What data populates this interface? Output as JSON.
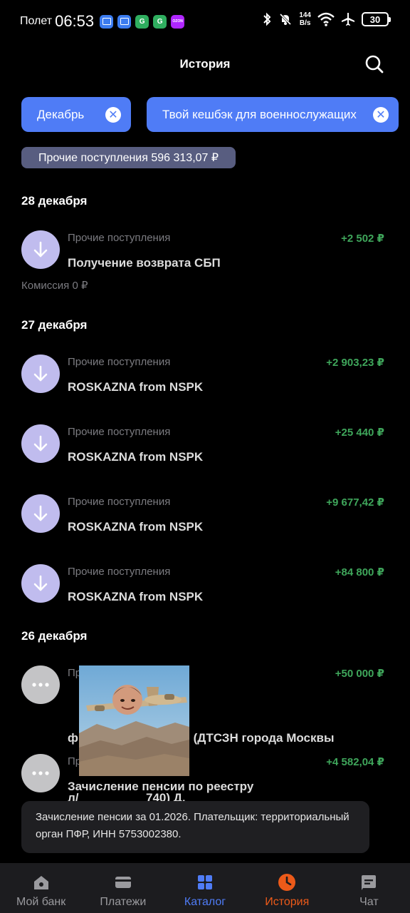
{
  "status_bar": {
    "carrier": "Полет",
    "time": "06:53",
    "app_icons": [
      {
        "name": "messages-app-icon",
        "color": "#3b7cf0",
        "glyph": "✉"
      },
      {
        "name": "messages2-app-icon",
        "color": "#3b7cf0",
        "glyph": "✉"
      },
      {
        "name": "green-app-icon",
        "color": "#2fae5f",
        "glyph": "G"
      },
      {
        "name": "green-app2-icon",
        "color": "#2fae5f",
        "glyph": "G"
      },
      {
        "name": "ozon-app-icon",
        "color": "#b026ff",
        "glyph": "OZON"
      }
    ],
    "speed_value": "144",
    "speed_unit": "B/s",
    "battery": "30"
  },
  "header": {
    "title": "История"
  },
  "filters": [
    {
      "label": "Декабрь"
    },
    {
      "label": "Твой кешбэк для военнослужащих"
    }
  ],
  "summary": "Прочие поступления 596 313,07 ₽",
  "groups": [
    {
      "date": "28 декабря",
      "items": [
        {
          "category": "Прочие поступления",
          "title": "Получение возврата СБП",
          "amount": "+2 502 ₽",
          "note": "Комиссия 0 ₽"
        }
      ]
    },
    {
      "date": "27 декабря",
      "items": [
        {
          "category": "Прочие поступления",
          "title": "ROSKAZNA from NSPK",
          "amount": "+2 903,23 ₽"
        },
        {
          "category": "Прочие поступления",
          "title": "ROSKAZNA from NSPK",
          "amount": "+25 440 ₽"
        },
        {
          "category": "Прочие поступления",
          "title": "ROSKAZNA from NSPK",
          "amount": "+9 677,42 ₽"
        },
        {
          "category": "Прочие поступления",
          "title": "ROSKAZNA from NSPK",
          "amount": "+84 800 ₽"
        }
      ]
    },
    {
      "date": "26 декабря",
      "items": [
        {
          "category": "Пр",
          "title_line1": "ф                      осквы (ДТСЗН города Москвы",
          "title_line2": "л/                    740) Д.",
          "amount": "+50 000 ₽"
        },
        {
          "category": "Пр",
          "title": "Зачисление пенсии по реестру",
          "amount": "+4 582,04 ₽"
        }
      ]
    }
  ],
  "tooltip": "Зачисление пенсии за 01.2026. Плательщик: территориальный орган ПФР, ИНН 5753002380.",
  "nav": [
    {
      "label": "Мой банк",
      "icon": "home-icon"
    },
    {
      "label": "Платежи",
      "icon": "card-icon"
    },
    {
      "label": "Каталог",
      "icon": "grid-icon"
    },
    {
      "label": "История",
      "icon": "clock-icon"
    },
    {
      "label": "Чат",
      "icon": "chat-icon"
    }
  ],
  "colors": {
    "accent": "#4f7cf6",
    "active_tab": "#ec5a19",
    "income": "#3fa65b",
    "income_icon_bg": "#c0bcee"
  }
}
